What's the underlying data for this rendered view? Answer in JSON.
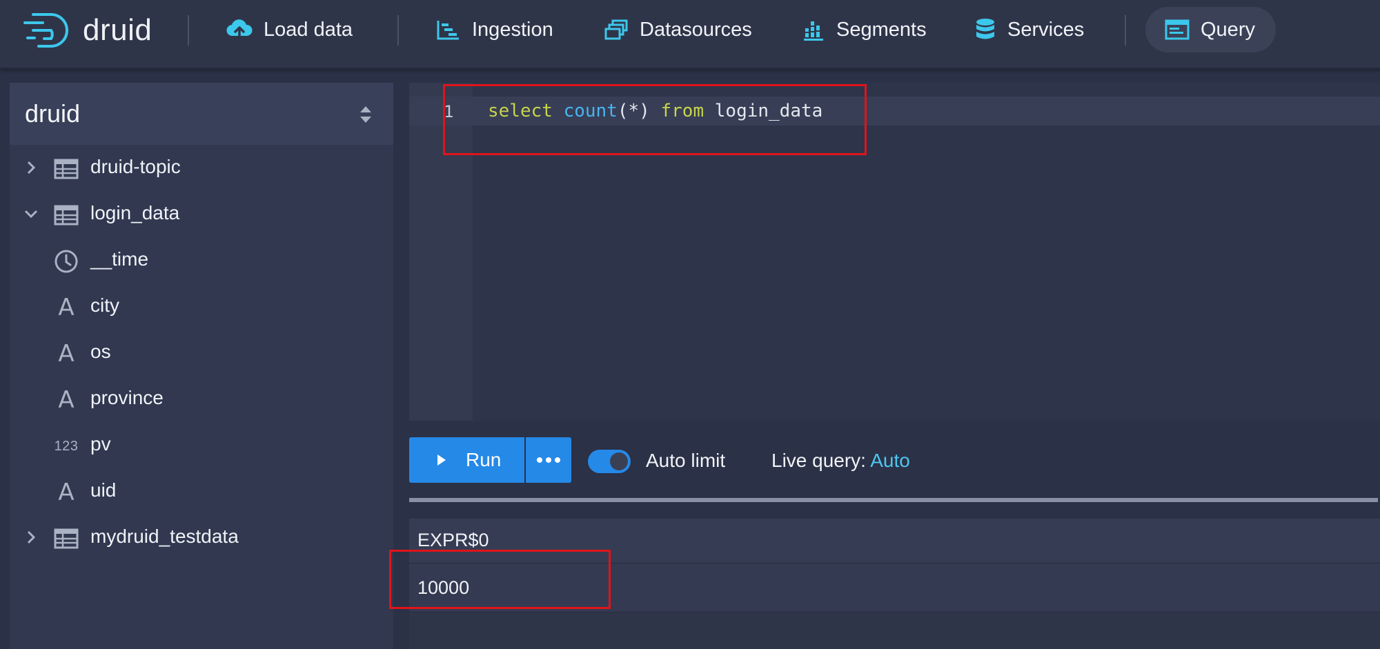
{
  "header": {
    "logo_text": "druid",
    "nav": [
      {
        "label": "Load data",
        "icon": "cloud-upload-icon"
      },
      {
        "label": "Ingestion",
        "icon": "gantt-chart-icon"
      },
      {
        "label": "Datasources",
        "icon": "multi-select-icon"
      },
      {
        "label": "Segments",
        "icon": "stacked-chart-icon"
      },
      {
        "label": "Services",
        "icon": "database-icon"
      },
      {
        "label": "Query",
        "icon": "application-icon",
        "active": true
      }
    ]
  },
  "sidebar": {
    "schema": "druid",
    "tree": [
      {
        "label": "druid-topic",
        "type": "table",
        "expanded": false
      },
      {
        "label": "login_data",
        "type": "table",
        "expanded": true
      },
      {
        "label": "__time",
        "type": "time-column"
      },
      {
        "label": "city",
        "type": "string-column",
        "glyph": "A"
      },
      {
        "label": "os",
        "type": "string-column",
        "glyph": "A"
      },
      {
        "label": "province",
        "type": "string-column",
        "glyph": "A"
      },
      {
        "label": "pv",
        "type": "number-column",
        "glyph": "123"
      },
      {
        "label": "uid",
        "type": "string-column",
        "glyph": "A"
      },
      {
        "label": "mydruid_testdata",
        "type": "table",
        "expanded": false
      }
    ]
  },
  "editor": {
    "line_number": "1",
    "tokens": [
      "select",
      " ",
      "count",
      "(*)",
      " ",
      "from",
      " ",
      "login_data"
    ]
  },
  "toolbar": {
    "run_label": "Run",
    "auto_limit_label": "Auto limit",
    "auto_limit_on": true,
    "live_query_label": "Live query:",
    "live_query_value": "Auto"
  },
  "results": {
    "columns": [
      "EXPR$0"
    ],
    "rows": [
      [
        "10000"
      ]
    ]
  },
  "colors": {
    "accent": "#2589e8",
    "keyword": "#c6d44a",
    "function": "#48b4f0",
    "highlight": "#e0141a"
  }
}
